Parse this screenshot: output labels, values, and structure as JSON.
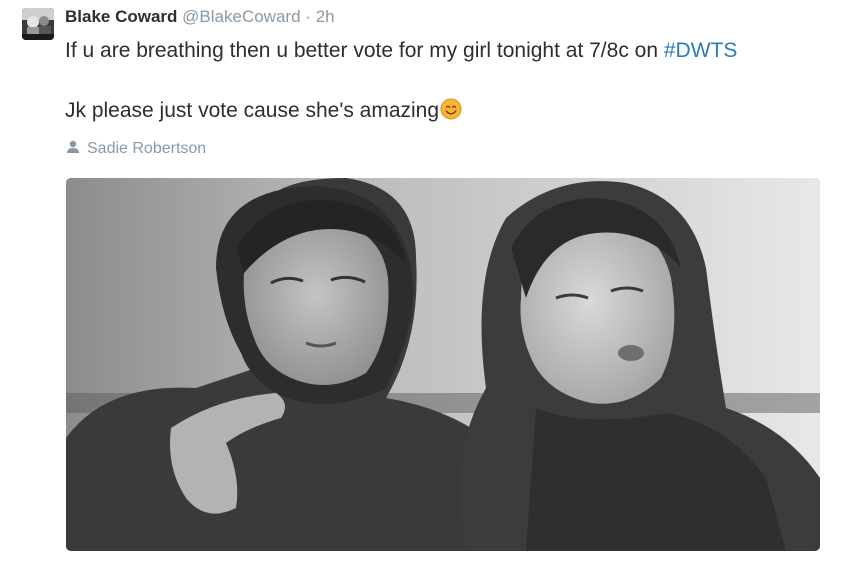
{
  "tweet": {
    "author": {
      "name": "Blake Coward",
      "handle": "@BlakeCoward",
      "separator": "·",
      "time": "2h"
    },
    "text": {
      "line1_prefix": "If u are breathing then u better vote for my girl tonight at 7/8c on ",
      "hashtag": "#DWTS",
      "line2": "Jk please just vote cause she's amazing"
    },
    "emoji": "smiling-face-emoji",
    "tagged_person": "Sadie Robertson",
    "photo": {
      "description_icon": "photo-image",
      "tone": "black-and-white"
    }
  },
  "colors": {
    "name": "#292f33",
    "meta": "#8899a6",
    "hashtag": "#2b7bb9"
  }
}
